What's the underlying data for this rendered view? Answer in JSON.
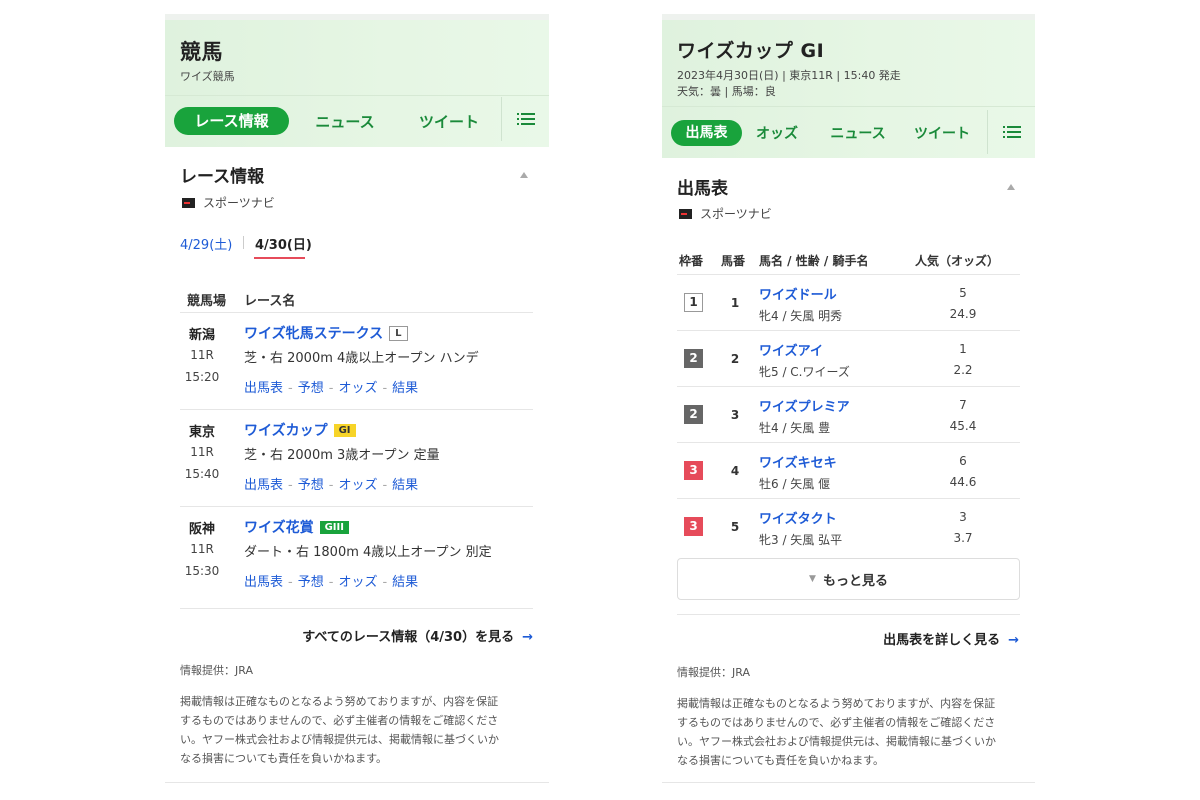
{
  "left": {
    "header": {
      "title": "競馬",
      "subtitle": "ワイズ競馬"
    },
    "tabs": [
      "レース情報",
      "ニュース",
      "ツイート"
    ],
    "section_title": "レース情報",
    "provider": "スポーツナビ",
    "dates": {
      "prev": "4/29(土)",
      "current": "4/30(日)"
    },
    "table_headers": {
      "venue": "競馬場",
      "race": "レース名"
    },
    "races": [
      {
        "venue": "新潟",
        "number": "11R",
        "time": "15:20",
        "name": "ワイズ牝馬ステークス",
        "grade": "L",
        "condition": "芝・右 2000m 4歳以上オープン ハンデ"
      },
      {
        "venue": "東京",
        "number": "11R",
        "time": "15:40",
        "name": "ワイズカップ",
        "grade": "GI",
        "condition": "芝・右 2000m 3歳オープン 定量"
      },
      {
        "venue": "阪神",
        "number": "11R",
        "time": "15:30",
        "name": "ワイズ花賞",
        "grade": "GIII",
        "condition": "ダート・右 1800m 4歳以上オープン 別定"
      }
    ],
    "race_links": [
      "出馬表",
      "予想",
      "オッズ",
      "結果"
    ],
    "see_all": "すべてのレース情報（4/30）を見る",
    "source_note": "情報提供：JRA",
    "disclaimer": [
      "掲載情報は正確なものとなるよう努めておりますが、内容を保証",
      "するものではありませんので、必ず主催者の情報をご確認くださ",
      "い。ヤフー株式会社および情報提供元は、掲載情報に基づくいか",
      "なる損害についても責任を負いかねます。"
    ]
  },
  "right": {
    "header": {
      "title": "ワイズカップ GI",
      "line1": "2023年4月30日(日) | 東京11R | 15:40 発走",
      "line2": "天気：曇 | 馬場：良"
    },
    "tabs": [
      "出馬表",
      "オッズ",
      "ニュース",
      "ツイート"
    ],
    "section_title": "出馬表",
    "provider": "スポーツナビ",
    "table_headers": {
      "waku": "枠番",
      "umaban": "馬番",
      "horse": "馬名 / 性齢 / 騎手名",
      "pop": "人気（オッズ）"
    },
    "horses": [
      {
        "waku": "1",
        "umaban": "1",
        "name": "ワイズドール",
        "info": "牝4 / 矢風 明秀",
        "popularity": "5",
        "odds": "24.9"
      },
      {
        "waku": "2",
        "umaban": "2",
        "name": "ワイズアイ",
        "info": "牝5 / C.ワイーズ",
        "popularity": "1",
        "odds": "2.2"
      },
      {
        "waku": "2",
        "umaban": "3",
        "name": "ワイズプレミア",
        "info": "牡4 / 矢風 豊",
        "popularity": "7",
        "odds": "45.4"
      },
      {
        "waku": "3",
        "umaban": "4",
        "name": "ワイズキセキ",
        "info": "牡6 / 矢風 偃",
        "popularity": "6",
        "odds": "44.6"
      },
      {
        "waku": "3",
        "umaban": "5",
        "name": "ワイズタクト",
        "info": "牝3 / 矢風 弘平",
        "popularity": "3",
        "odds": "3.7"
      }
    ],
    "more_label": "もっと見る",
    "detail_link": "出馬表を詳しく見る",
    "source_note": "情報提供：JRA",
    "disclaimer": [
      "掲載情報は正確なものとなるよう努めておりますが、内容を保証",
      "するものではありませんので、必ず主催者の情報をご確認くださ",
      "い。ヤフー株式会社および情報提供元は、掲載情報に基づくいか",
      "なる損害についても責任を負いかねます。"
    ]
  },
  "icons": {
    "menu": "list-menu-icon",
    "collapse": "caret-up-icon",
    "more": "caret-down-icon",
    "arrow": "arrow-right-icon"
  }
}
